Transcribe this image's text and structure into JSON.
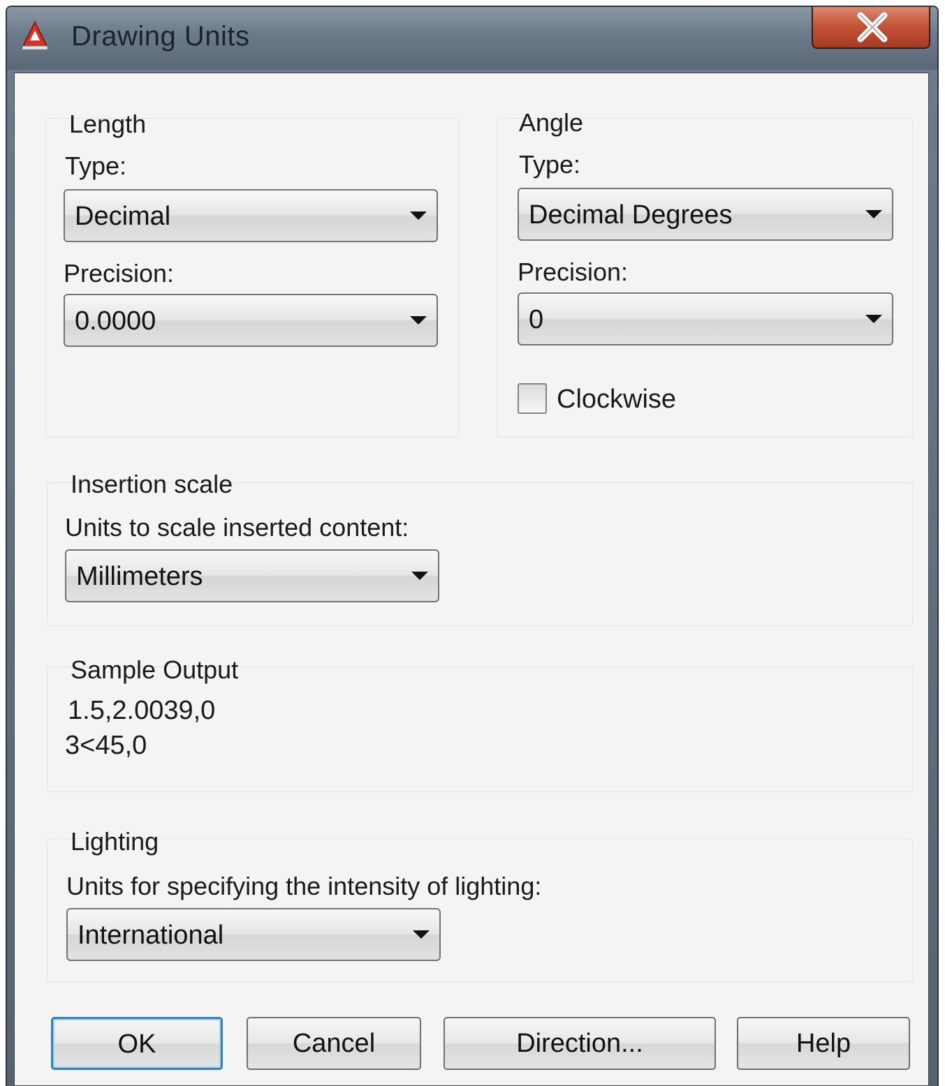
{
  "window": {
    "title": "Drawing Units",
    "close_label": "X"
  },
  "length": {
    "group_title": "Length",
    "type_label": "Type:",
    "type_value": "Decimal",
    "precision_label": "Precision:",
    "precision_value": "0.0000"
  },
  "angle": {
    "group_title": "Angle",
    "type_label": "Type:",
    "type_value": "Decimal Degrees",
    "precision_label": "Precision:",
    "precision_value": "0",
    "clockwise_label": "Clockwise",
    "clockwise_checked": false
  },
  "insertion_scale": {
    "group_title": "Insertion scale",
    "units_label": "Units to scale inserted content:",
    "units_value": "Millimeters"
  },
  "sample_output": {
    "group_title": "Sample Output",
    "lines": [
      "1.5,2.0039,0",
      "3<45,0"
    ]
  },
  "lighting": {
    "group_title": "Lighting",
    "units_label": "Units for specifying the intensity of lighting:",
    "units_value": "International"
  },
  "buttons": {
    "ok": "OK",
    "cancel": "Cancel",
    "direction": "Direction...",
    "help": "Help"
  },
  "icons": {
    "app": "autocad-logo-icon",
    "close": "close-icon",
    "dropdown": "chevron-down-icon"
  },
  "colors": {
    "titlebar": "#6b7a89",
    "close_button": "#c4553a",
    "default_button_border": "#3c7fb1",
    "logo_red": "#d8322a"
  }
}
